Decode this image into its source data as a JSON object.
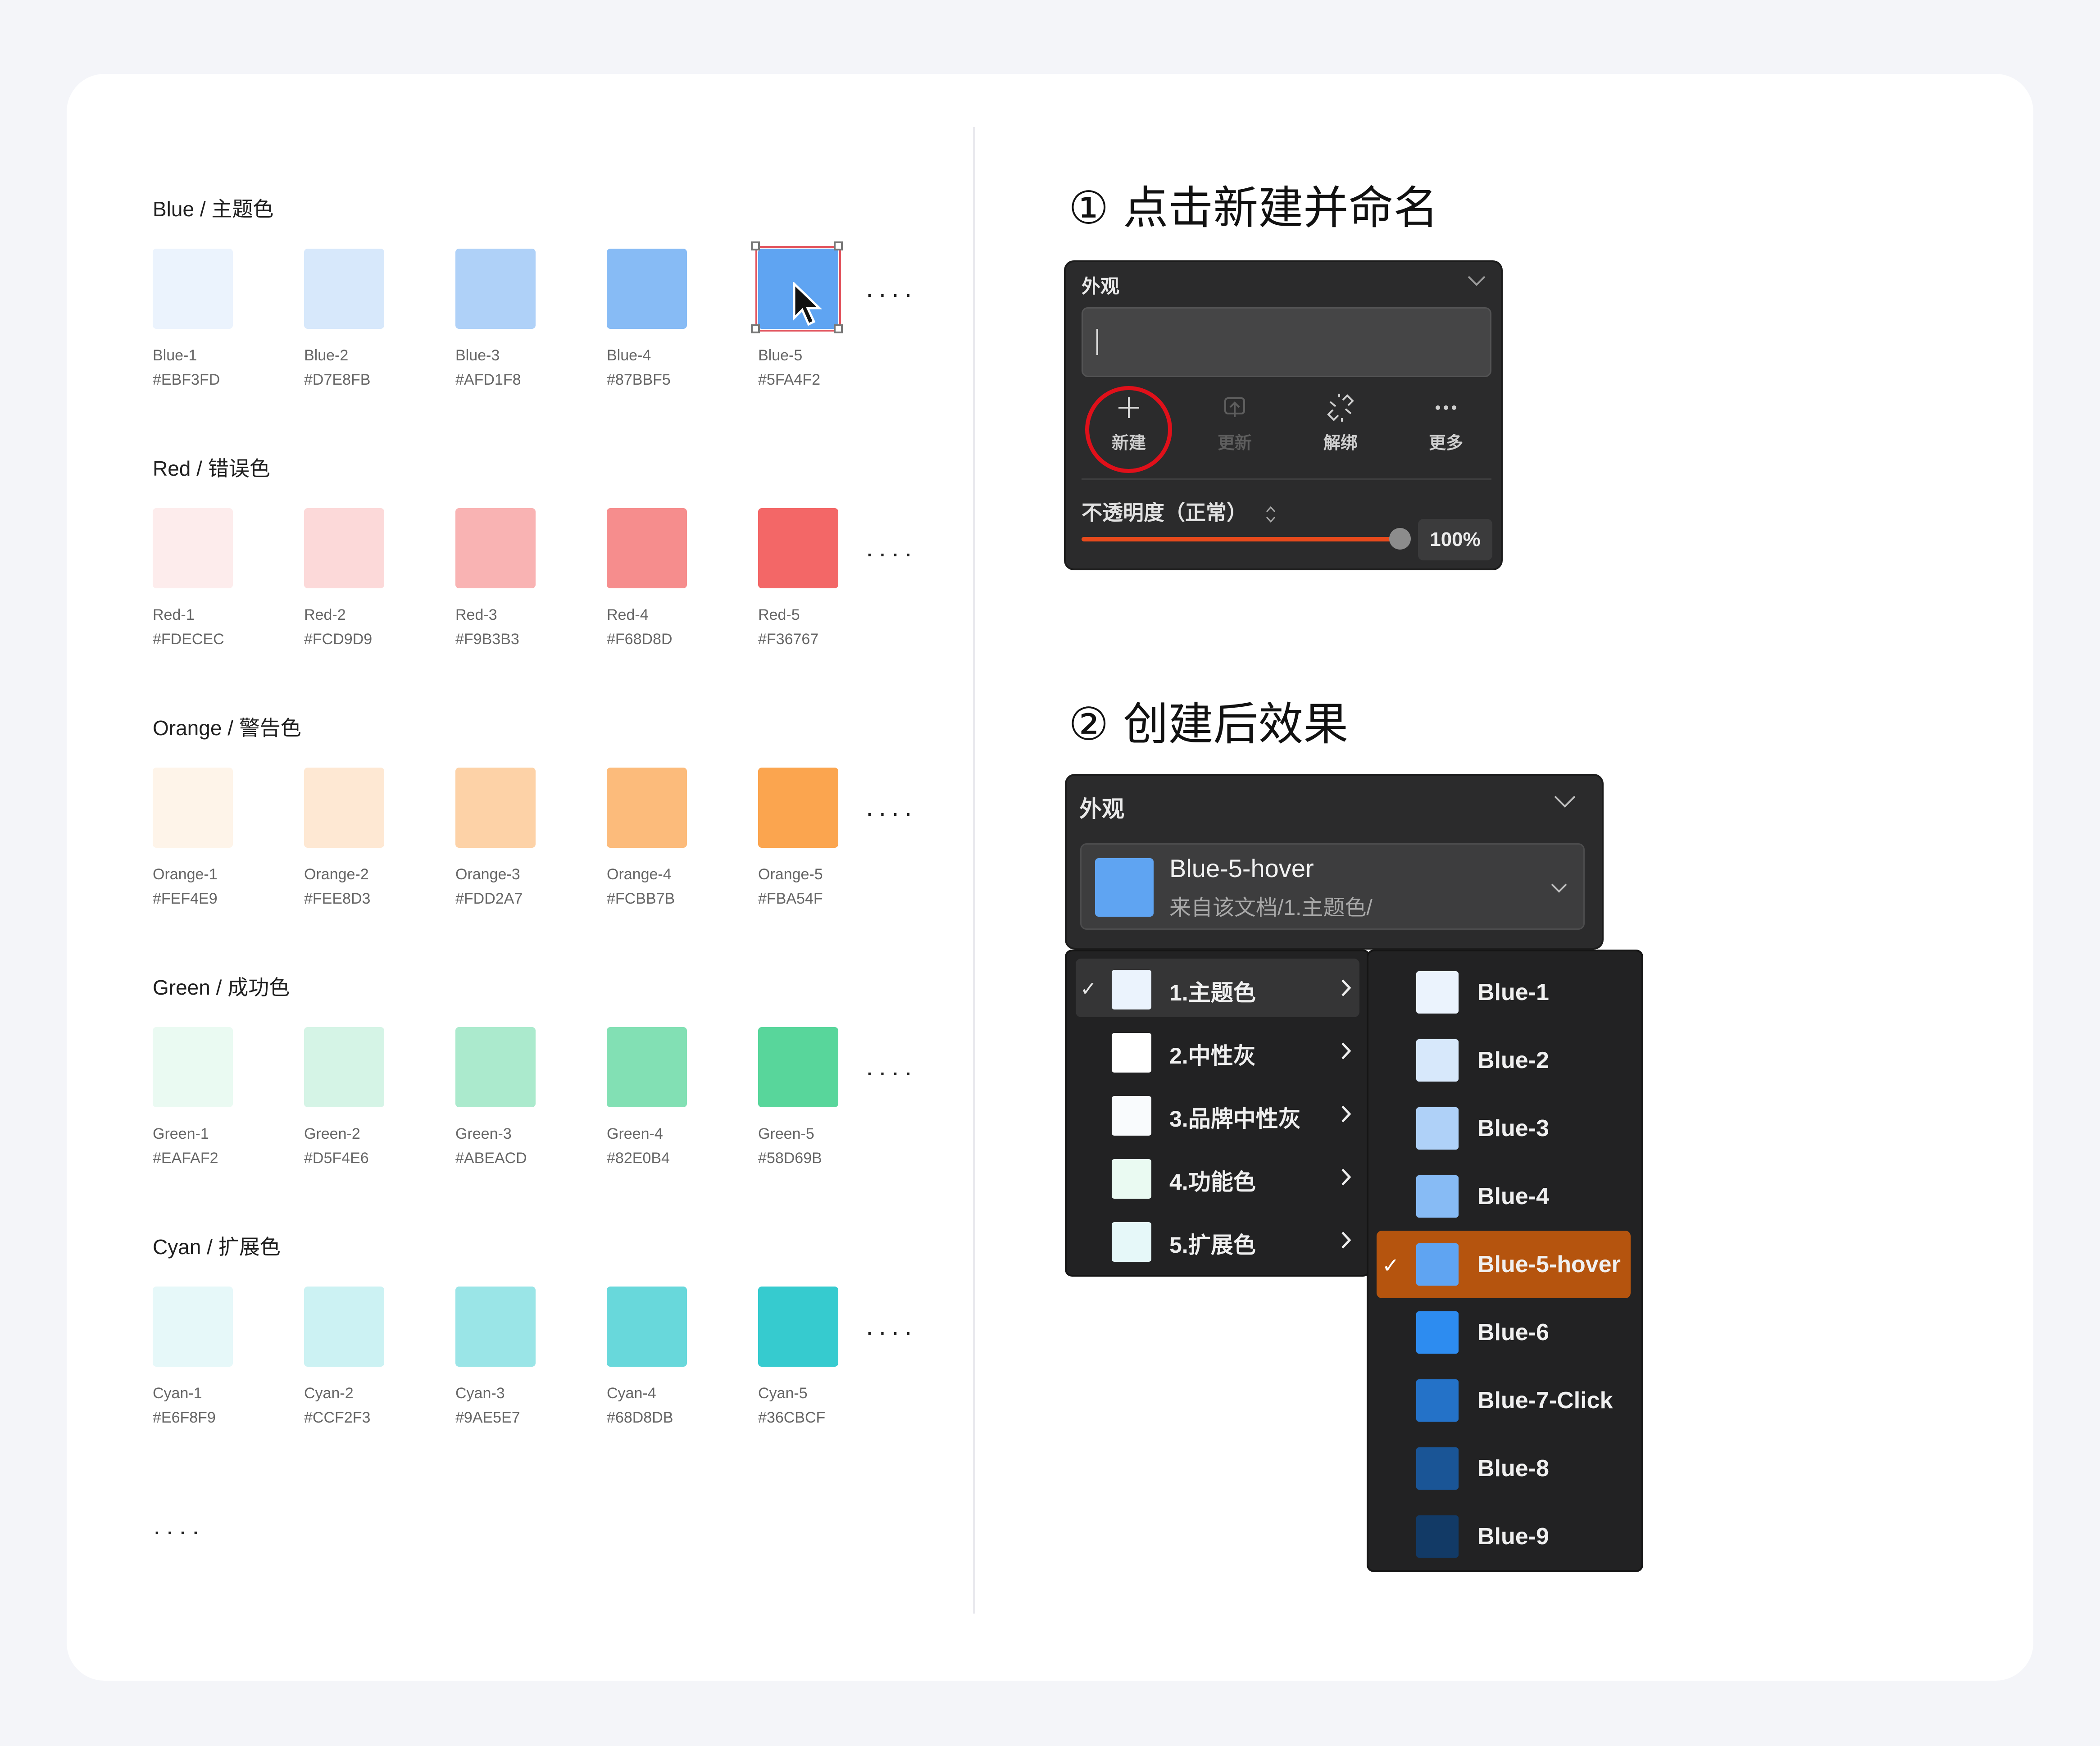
{
  "palette_groups": [
    {
      "title": "Blue / 主题色",
      "swatches": [
        {
          "name": "Blue-1",
          "hex": "#EBF3FD"
        },
        {
          "name": "Blue-2",
          "hex": "#D7E8FB"
        },
        {
          "name": "Blue-3",
          "hex": "#AFD1F8"
        },
        {
          "name": "Blue-4",
          "hex": "#87BBF5"
        },
        {
          "name": "Blue-5",
          "hex": "#5FA4F2"
        }
      ]
    },
    {
      "title": "Red / 错误色",
      "swatches": [
        {
          "name": "Red-1",
          "hex": "#FDECEC"
        },
        {
          "name": "Red-2",
          "hex": "#FCD9D9"
        },
        {
          "name": "Red-3",
          "hex": "#F9B3B3"
        },
        {
          "name": "Red-4",
          "hex": "#F68D8D"
        },
        {
          "name": "Red-5",
          "hex": "#F36767"
        }
      ]
    },
    {
      "title": "Orange / 警告色",
      "swatches": [
        {
          "name": "Orange-1",
          "hex": "#FEF4E9"
        },
        {
          "name": "Orange-2",
          "hex": "#FEE8D3"
        },
        {
          "name": "Orange-3",
          "hex": "#FDD2A7"
        },
        {
          "name": "Orange-4",
          "hex": "#FCBB7B"
        },
        {
          "name": "Orange-5",
          "hex": "#FBA54F"
        }
      ]
    },
    {
      "title": "Green / 成功色",
      "swatches": [
        {
          "name": "Green-1",
          "hex": "#EAFAF2"
        },
        {
          "name": "Green-2",
          "hex": "#D5F4E6"
        },
        {
          "name": "Green-3",
          "hex": "#ABEACD"
        },
        {
          "name": "Green-4",
          "hex": "#82E0B4"
        },
        {
          "name": "Green-5",
          "hex": "#58D69B"
        }
      ]
    },
    {
      "title": "Cyan / 扩展色",
      "swatches": [
        {
          "name": "Cyan-1",
          "hex": "#E6F8F9"
        },
        {
          "name": "Cyan-2",
          "hex": "#CCF2F3"
        },
        {
          "name": "Cyan-3",
          "hex": "#9AE5E7"
        },
        {
          "name": "Cyan-4",
          "hex": "#68D8DB"
        },
        {
          "name": "Cyan-5",
          "hex": "#36CBCF"
        }
      ]
    }
  ],
  "more_dots": "····",
  "step1": {
    "heading": "① 点击新建并命名",
    "panel_title": "外观",
    "buttons": [
      {
        "label": "新建",
        "icon": "plus-icon",
        "enabled": true
      },
      {
        "label": "更新",
        "icon": "update-icon",
        "enabled": false
      },
      {
        "label": "解绑",
        "icon": "unlink-icon",
        "enabled": true
      },
      {
        "label": "更多",
        "icon": "more-icon",
        "enabled": true
      }
    ],
    "opacity_label": "不透明度（正常）",
    "opacity_value": "100%",
    "opacity_fraction": 1.0,
    "accent": "#e84a1c"
  },
  "step2": {
    "heading": "② 创建后效果",
    "panel_title": "外观",
    "selected_name": "Blue-5-hover",
    "selected_source": "来自该文档/1.主题色/",
    "selected_color": "#5FA4F2",
    "groups": [
      {
        "label": "1.主题色",
        "color": "#EBF3FD",
        "checked": true
      },
      {
        "label": "2.中性灰",
        "color": "#FFFFFF",
        "checked": false
      },
      {
        "label": "3.品牌中性灰",
        "color": "#F9FBFD",
        "checked": false
      },
      {
        "label": "4.功能色",
        "color": "#EAFAF2",
        "checked": false
      },
      {
        "label": "5.扩展色",
        "color": "#E6F8F9",
        "checked": false
      }
    ],
    "styles": [
      {
        "label": "Blue-1",
        "color": "#EBF3FD",
        "checked": false
      },
      {
        "label": "Blue-2",
        "color": "#D7E8FB",
        "checked": false
      },
      {
        "label": "Blue-3",
        "color": "#AFD1F8",
        "checked": false
      },
      {
        "label": "Blue-4",
        "color": "#87BBF5",
        "checked": false
      },
      {
        "label": "Blue-5-hover",
        "color": "#5FA4F2",
        "checked": true
      },
      {
        "label": "Blue-6",
        "color": "#2D8CF0",
        "checked": false
      },
      {
        "label": "Blue-7-Click",
        "color": "#2472C8",
        "checked": false
      },
      {
        "label": "Blue-8",
        "color": "#1A5596",
        "checked": false
      },
      {
        "label": "Blue-9",
        "color": "#123A66",
        "checked": false
      }
    ],
    "active_color": "#B5540E"
  }
}
